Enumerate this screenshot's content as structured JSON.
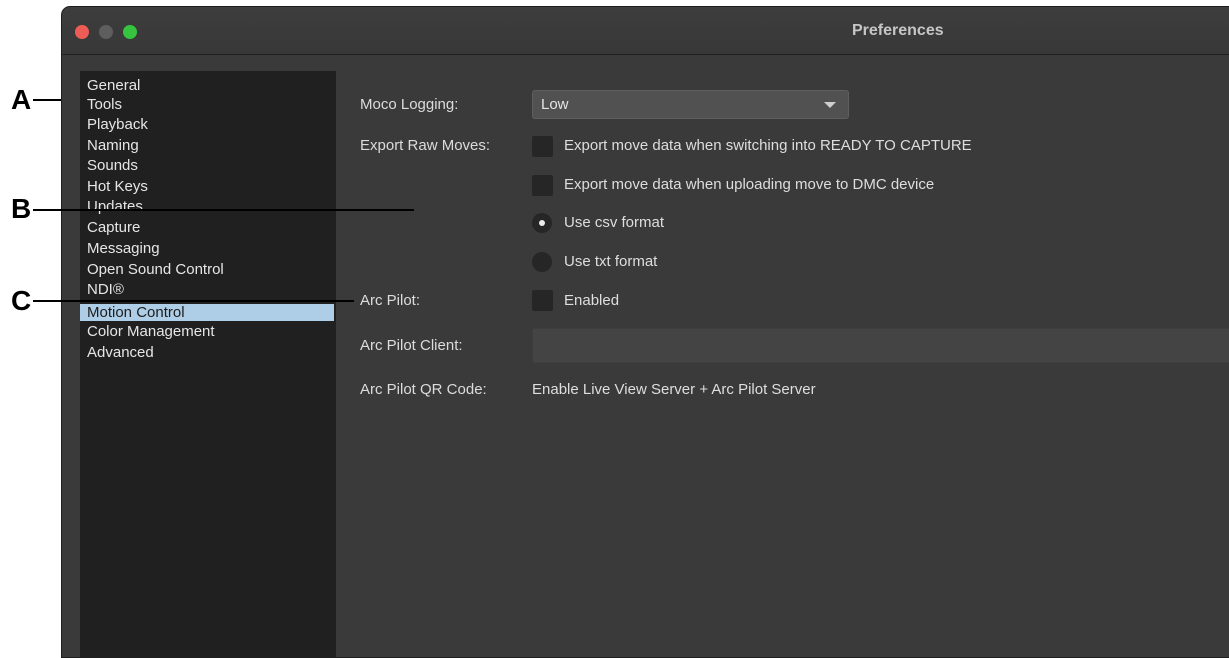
{
  "window": {
    "title": "Preferences"
  },
  "sidebar": {
    "items": [
      {
        "label": "General"
      },
      {
        "label": "Tools"
      },
      {
        "label": "Playback"
      },
      {
        "label": "Naming"
      },
      {
        "label": "Sounds"
      },
      {
        "label": "Hot Keys"
      },
      {
        "label": "Updates"
      },
      {
        "label": "Capture"
      },
      {
        "label": "Messaging"
      },
      {
        "label": "Open Sound Control"
      },
      {
        "label": "NDI®"
      },
      {
        "label": "Motion Control",
        "selected": true
      },
      {
        "label": "Color Management"
      },
      {
        "label": "Advanced"
      }
    ]
  },
  "motion_control": {
    "moco_logging": {
      "label": "Moco Logging:",
      "value": "Low"
    },
    "export_raw_moves": {
      "label": "Export Raw Moves:",
      "option_ready": {
        "label": "Export move data when switching into READY TO CAPTURE",
        "checked": false
      },
      "option_upload": {
        "label": "Export move data when uploading move to DMC device",
        "checked": false
      },
      "format_csv": {
        "label": "Use csv format",
        "selected": true
      },
      "format_txt": {
        "label": "Use txt format",
        "selected": false
      }
    },
    "arc_pilot": {
      "label": "Arc Pilot:",
      "checkbox_label": "Enabled",
      "checked": false
    },
    "arc_pilot_client": {
      "label": "Arc Pilot Client:",
      "value": ""
    },
    "arc_pilot_qr": {
      "label": "Arc Pilot QR Code:",
      "value": "Enable Live View Server + Arc Pilot Server"
    }
  },
  "callouts": {
    "a": "A",
    "b": "B",
    "c": "C"
  },
  "colors": {
    "window_bg": "#3a3a3a",
    "sidebar_bg": "#202020",
    "selection": "#aecde6",
    "close": "#ee5d55",
    "maximize": "#36c440"
  }
}
